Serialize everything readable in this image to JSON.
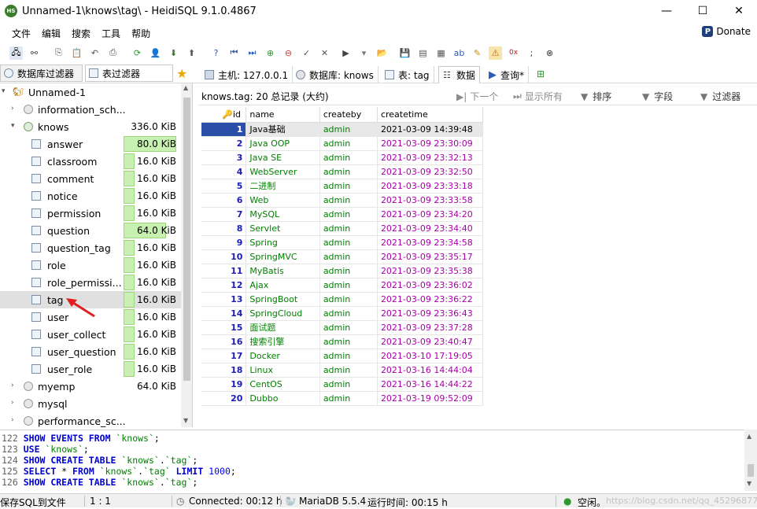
{
  "window": {
    "title": "Unnamed-1\\knows\\tag\\ - HeidiSQL 9.1.0.4867",
    "app_icon_text": "HS",
    "minimize": "—",
    "maximize": "☐",
    "close": "✕"
  },
  "menu": {
    "items": [
      "文件",
      "编辑",
      "搜索",
      "工具",
      "帮助"
    ],
    "donate": "Donate"
  },
  "left_tabs": {
    "db_filter": "数据库过滤器",
    "table_filter": "表过滤器"
  },
  "right_tabs": {
    "host": "主机: 127.0.0.1",
    "database": "数据库: knows",
    "table": "表: tag",
    "data": "数据",
    "query": "查询*"
  },
  "tree": {
    "session": "Unnamed-1",
    "databases": [
      {
        "name": "information_sch...",
        "size": ""
      },
      {
        "name": "knows",
        "size": "336.0 KiB"
      }
    ],
    "tables": [
      {
        "name": "answer",
        "size": "80.0 KiB",
        "fill": 0.96
      },
      {
        "name": "classroom",
        "size": "16.0 KiB",
        "fill": 0.2
      },
      {
        "name": "comment",
        "size": "16.0 KiB",
        "fill": 0.2
      },
      {
        "name": "notice",
        "size": "16.0 KiB",
        "fill": 0.2
      },
      {
        "name": "permission",
        "size": "16.0 KiB",
        "fill": 0.2
      },
      {
        "name": "question",
        "size": "64.0 KiB",
        "fill": 0.77
      },
      {
        "name": "question_tag",
        "size": "16.0 KiB",
        "fill": 0.2
      },
      {
        "name": "role",
        "size": "16.0 KiB",
        "fill": 0.2
      },
      {
        "name": "role_permissi...",
        "size": "16.0 KiB",
        "fill": 0.2
      },
      {
        "name": "tag",
        "size": "16.0 KiB",
        "fill": 0.2
      },
      {
        "name": "user",
        "size": "16.0 KiB",
        "fill": 0.2
      },
      {
        "name": "user_collect",
        "size": "16.0 KiB",
        "fill": 0.2
      },
      {
        "name": "user_question",
        "size": "16.0 KiB",
        "fill": 0.2
      },
      {
        "name": "user_role",
        "size": "16.0 KiB",
        "fill": 0.2
      }
    ],
    "other_databases": [
      {
        "name": "myemp",
        "size": "64.0 KiB"
      },
      {
        "name": "mysql",
        "size": ""
      },
      {
        "name": "performance_sc...",
        "size": ""
      }
    ]
  },
  "data_panel": {
    "info": "knows.tag: 20 总记录 (大约)",
    "next": "下一个",
    "show_all": "显示所有",
    "sort": "排序",
    "columns_btn": "字段",
    "filter": "过滤器",
    "columns": [
      "id",
      "name",
      "createby",
      "createtime"
    ],
    "rows": [
      [
        "1",
        "Java基础",
        "admin",
        "2021-03-09 14:39:48"
      ],
      [
        "2",
        "Java OOP",
        "admin",
        "2021-03-09 23:30:09"
      ],
      [
        "3",
        "Java SE",
        "admin",
        "2021-03-09 23:32:13"
      ],
      [
        "4",
        "WebServer",
        "admin",
        "2021-03-09 23:32:50"
      ],
      [
        "5",
        "二进制",
        "admin",
        "2021-03-09 23:33:18"
      ],
      [
        "6",
        "Web",
        "admin",
        "2021-03-09 23:33:58"
      ],
      [
        "7",
        "MySQL",
        "admin",
        "2021-03-09 23:34:20"
      ],
      [
        "8",
        "Servlet",
        "admin",
        "2021-03-09 23:34:40"
      ],
      [
        "9",
        "Spring",
        "admin",
        "2021-03-09 23:34:58"
      ],
      [
        "10",
        "SpringMVC",
        "admin",
        "2021-03-09 23:35:17"
      ],
      [
        "11",
        "MyBatis",
        "admin",
        "2021-03-09 23:35:38"
      ],
      [
        "12",
        "Ajax",
        "admin",
        "2021-03-09 23:36:02"
      ],
      [
        "13",
        "SpringBoot",
        "admin",
        "2021-03-09 23:36:22"
      ],
      [
        "14",
        "SpringCloud",
        "admin",
        "2021-03-09 23:36:43"
      ],
      [
        "15",
        "面试题",
        "admin",
        "2021-03-09 23:37:28"
      ],
      [
        "16",
        "搜索引擎",
        "admin",
        "2021-03-09 23:40:47"
      ],
      [
        "17",
        "Docker",
        "admin",
        "2021-03-10 17:19:05"
      ],
      [
        "18",
        "Linux",
        "admin",
        "2021-03-16 14:44:04"
      ],
      [
        "19",
        "CentOS",
        "admin",
        "2021-03-16 14:44:22"
      ],
      [
        "20",
        "Dubbo",
        "admin",
        "2021-03-19 09:52:09"
      ]
    ]
  },
  "sql_log": [
    {
      "num": "122",
      "parts": [
        [
          "kw",
          "SHOW EVENTS FROM "
        ],
        [
          "str",
          "`knows`"
        ],
        [
          "txt",
          ";"
        ]
      ]
    },
    {
      "num": "123",
      "parts": [
        [
          "kw",
          "USE "
        ],
        [
          "str",
          "`knows`"
        ],
        [
          "txt",
          ";"
        ]
      ]
    },
    {
      "num": "124",
      "parts": [
        [
          "kw",
          "SHOW CREATE TABLE "
        ],
        [
          "str",
          "`knows`"
        ],
        [
          "txt",
          "."
        ],
        [
          "str",
          "`tag`"
        ],
        [
          "txt",
          ";"
        ]
      ]
    },
    {
      "num": "125",
      "parts": [
        [
          "kw",
          "SELECT "
        ],
        [
          "txt",
          "* "
        ],
        [
          "kw",
          "FROM "
        ],
        [
          "str",
          "`knows`"
        ],
        [
          "txt",
          "."
        ],
        [
          "str",
          "`tag`"
        ],
        [
          "kw",
          " LIMIT "
        ],
        [
          "num",
          "1000"
        ],
        [
          "txt",
          ";"
        ]
      ]
    },
    {
      "num": "126",
      "parts": [
        [
          "kw",
          "SHOW CREATE TABLE "
        ],
        [
          "str",
          "`knows`"
        ],
        [
          "txt",
          "."
        ],
        [
          "str",
          "`tag`"
        ],
        [
          "txt",
          ";"
        ]
      ]
    }
  ],
  "status": {
    "save_sql": "保存SQL到文件",
    "position": "1 : 1",
    "connected": "Connected: 00:12 h",
    "server": "MariaDB 5.5.4",
    "uptime": "运行时间: 00:15 h",
    "idle": "空闲。",
    "watermark": "https://blog.csdn.net/qq_45296877"
  },
  "colors": {
    "selection_blue": "#2b4fa8",
    "size_bar_green": "#c8f0b0",
    "text_green": "#008000",
    "date_purple": "#aa00aa",
    "arrow_red": "#e02020"
  }
}
